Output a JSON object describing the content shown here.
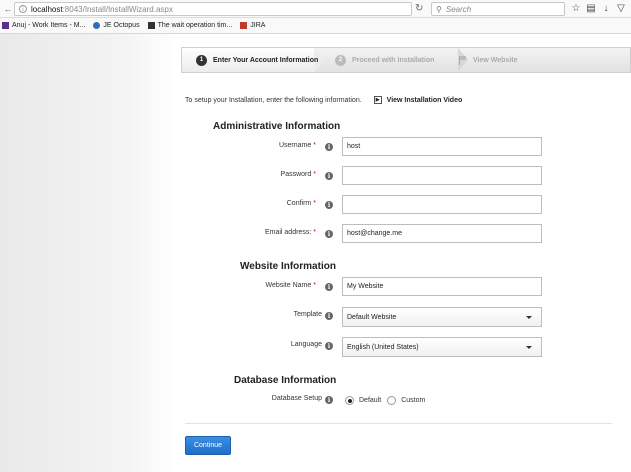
{
  "browser": {
    "url_host": "localhost",
    "url_path": ":8043/Install/InstallWizard.aspx",
    "search_placeholder": "Search",
    "bookmarks": [
      {
        "label": "Anuj - Work Items - M..."
      },
      {
        "label": "JE Octopus"
      },
      {
        "label": "The wait operation tim..."
      },
      {
        "label": "JIRA"
      }
    ]
  },
  "wizard": {
    "steps": [
      {
        "num": "1",
        "label": "Enter Your Account Information"
      },
      {
        "num": "2",
        "label": "Proceed with Installation"
      },
      {
        "label": "View Website"
      }
    ]
  },
  "intro": {
    "text": "To setup your Installation, enter the following information.",
    "video_link": "View Installation Video"
  },
  "admin": {
    "title": "Administrative Information",
    "username_label": "Username",
    "username_value": "host",
    "password_label": "Password",
    "password_value": "",
    "confirm_label": "Confirm",
    "confirm_value": "",
    "email_label": "Email address:",
    "email_value": "host@change.me"
  },
  "website": {
    "title": "Website Information",
    "name_label": "Website Name",
    "name_value": "My Website",
    "template_label": "Template",
    "template_value": "Default Website",
    "language_label": "Language",
    "language_value": "English (United States)"
  },
  "database": {
    "title": "Database Information",
    "setup_label": "Database Setup",
    "option_default": "Default",
    "option_custom": "Custom",
    "selected": "Default"
  },
  "required_marker": "*",
  "continue_label": "Continue",
  "colors": {
    "primary_button": "#2a7fd8",
    "required": "#dd0000"
  }
}
